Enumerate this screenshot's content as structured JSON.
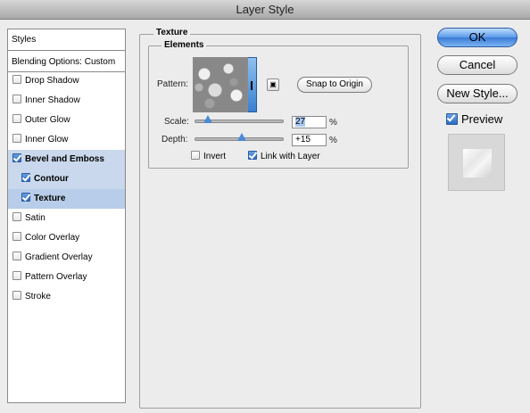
{
  "window": {
    "title": "Layer Style"
  },
  "styles_list": {
    "header": "Styles",
    "blending": "Blending Options: Custom",
    "items": [
      {
        "label": "Drop Shadow",
        "checked": false,
        "bold": false
      },
      {
        "label": "Inner Shadow",
        "checked": false,
        "bold": false
      },
      {
        "label": "Outer Glow",
        "checked": false,
        "bold": false
      },
      {
        "label": "Inner Glow",
        "checked": false,
        "bold": false
      },
      {
        "label": "Bevel and Emboss",
        "checked": true,
        "bold": true
      },
      {
        "label": "Contour",
        "checked": true,
        "bold": true,
        "sub": true
      },
      {
        "label": "Texture",
        "checked": true,
        "bold": true,
        "sub": true
      },
      {
        "label": "Satin",
        "checked": false,
        "bold": false
      },
      {
        "label": "Color Overlay",
        "checked": false,
        "bold": false
      },
      {
        "label": "Gradient Overlay",
        "checked": false,
        "bold": false
      },
      {
        "label": "Pattern Overlay",
        "checked": false,
        "bold": false
      },
      {
        "label": "Stroke",
        "checked": false,
        "bold": false
      }
    ]
  },
  "texture": {
    "section_title": "Texture",
    "group_title": "Elements",
    "pattern_label": "Pattern:",
    "snap_button": "Snap to Origin",
    "scale_label": "Scale:",
    "scale_value": "27",
    "scale_unit": "%",
    "scale_fraction": 0.27,
    "depth_label": "Depth:",
    "depth_value": "+15",
    "depth_unit": "%",
    "invert_label": "Invert",
    "invert_checked": false,
    "link_label": "Link with Layer",
    "link_checked": true
  },
  "actions": {
    "ok": "OK",
    "cancel": "Cancel",
    "new_style": "New Style...",
    "preview_label": "Preview",
    "preview_checked": true
  },
  "icons": {
    "checkbox": "checkbox-icon",
    "pattern_dropdown": "pattern-dropdown-icon",
    "new_preset": "new-preset-icon"
  }
}
